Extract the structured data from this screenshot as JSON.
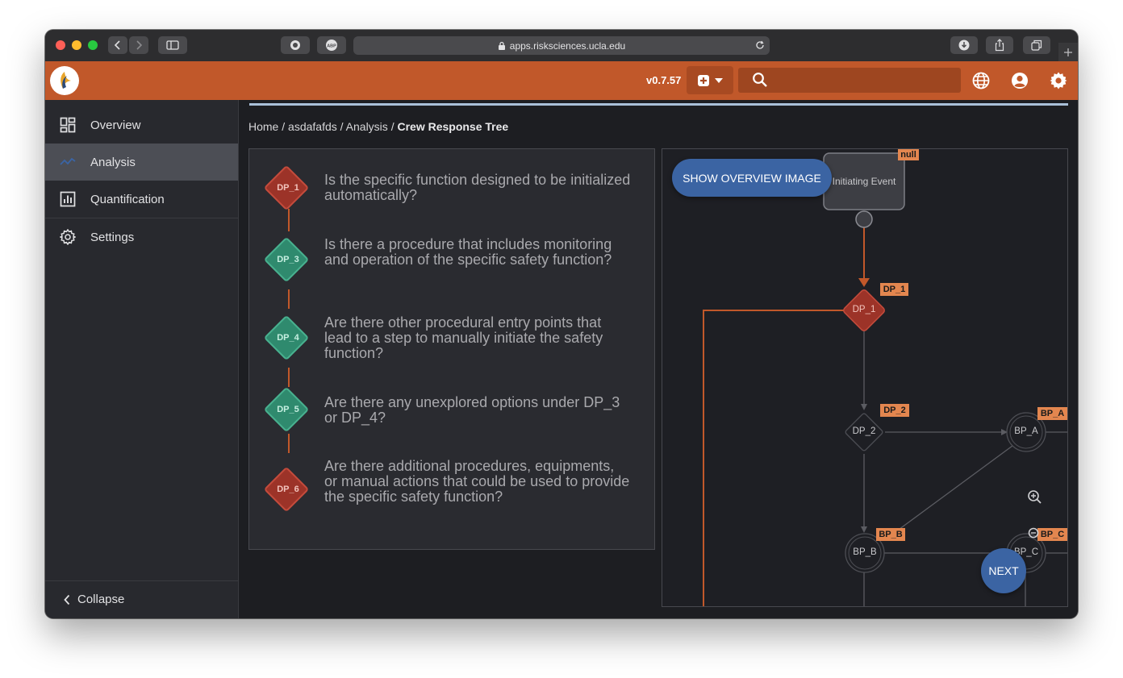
{
  "browser": {
    "url": "apps.risksciences.ucla.edu"
  },
  "appbar": {
    "version": "v0.7.57",
    "search_placeholder": ""
  },
  "sidebar": {
    "items": [
      {
        "label": "Overview",
        "icon": "dashboard-icon"
      },
      {
        "label": "Analysis",
        "icon": "analysis-icon"
      },
      {
        "label": "Quantification",
        "icon": "bar-chart-icon"
      },
      {
        "label": "Settings",
        "icon": "gear-icon"
      }
    ],
    "collapse_label": "Collapse"
  },
  "breadcrumb": {
    "home": "Home",
    "project": "asdafafds",
    "section": "Analysis",
    "current": "Crew Response Tree",
    "sep": "/"
  },
  "questions": [
    {
      "id": "DP_1",
      "color": "#9c3328",
      "text": "Is the specific function designed to be initialized automatically?"
    },
    {
      "id": "DP_3",
      "color": "#2f8a6e",
      "text": "Is there a procedure that includes monitoring and operation of the specific safety function?"
    },
    {
      "id": "DP_4",
      "color": "#2f8a6e",
      "text": "Are there other procedural entry points that lead to a step to manually initiate the safety function?"
    },
    {
      "id": "DP_5",
      "color": "#2f8a6e",
      "text": "Are there any unexplored options under DP_3 or DP_4?"
    },
    {
      "id": "DP_6",
      "color": "#9c3328",
      "text": "Are there additional procedures, equipments, or manual actions that could be used to provide the specific safety function?"
    }
  ],
  "diagram": {
    "show_overview_label": "SHOW OVERVIEW IMAGE",
    "next_label": "NEXT",
    "initiating_event": "Initiating Event",
    "null_tag": "null",
    "nodes": {
      "dp1": "DP_1",
      "dp2": "DP_2",
      "bpa": "BP_A",
      "bpb": "BP_B",
      "bpc": "BP_C"
    },
    "tags": {
      "dp1": "DP_1",
      "dp2": "DP_2",
      "bpa": "BP_A",
      "bpb": "BP_B",
      "bpc": "BP_C"
    }
  },
  "colors": {
    "accent": "#c1582a",
    "primary_button": "#3b64a3",
    "tag": "#e3864f"
  }
}
